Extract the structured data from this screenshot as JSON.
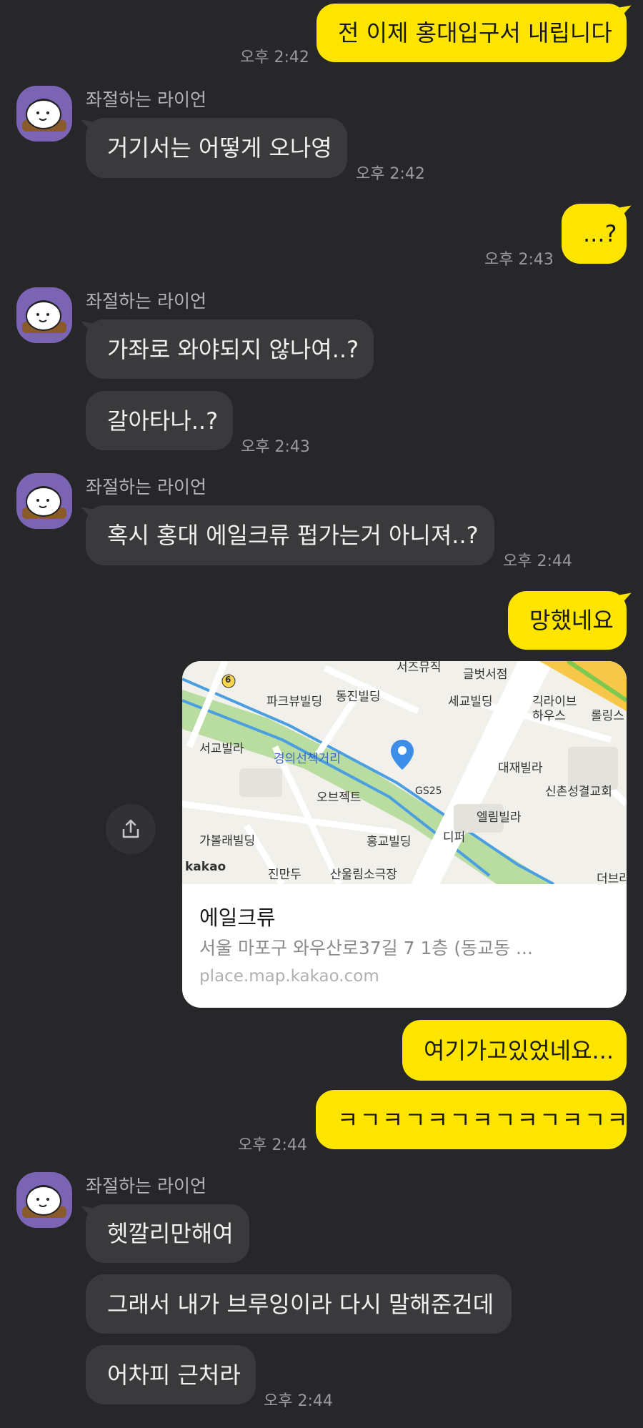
{
  "sender_name": "좌절하는 라이언",
  "colors": {
    "background": "#27272a",
    "incoming_bubble": "#3a3a3d",
    "outgoing_bubble": "#fee500",
    "avatar": "#7b64b4"
  },
  "messages": [
    {
      "text": "전 이제 홍대입구서 내립니다",
      "time": "오후 2:42"
    },
    {
      "text": "거기서는 어떻게 오나영",
      "time": "오후 2:42"
    },
    {
      "text": "...?",
      "time": "오후 2:43"
    },
    {
      "text": "가좌로 와야되지 않나여..?"
    },
    {
      "text": "갈아타나..?",
      "time": "오후 2:43"
    },
    {
      "text": "혹시 홍대 에일크류 펍가는거 아니져..?",
      "time": "오후 2:44"
    },
    {
      "text": "망했네요"
    },
    {
      "text": "여기가고있었네요..."
    },
    {
      "text": "ㅋㄱㅋㄱㅋㄱㅋㄱㅋㄱㅋㄱㅋ",
      "time": "오후 2:44"
    },
    {
      "text": "헷깔리만해여"
    },
    {
      "text": "그래서 내가 브루잉이라 다시 말해준건데"
    },
    {
      "text": "어차피 근처라",
      "time": "오후 2:44"
    }
  ],
  "place_card": {
    "title": "에일크류",
    "address": "서울 마포구 와우산로37길 7 1층 (동교동 ...",
    "url": "place.map.kakao.com",
    "map_labels": [
      "서즈뮤직",
      "글벗서점",
      "파크뷰빌딩",
      "동진빌딩",
      "세교빌딩",
      "긱라이브 하우스",
      "롤링스",
      "서교빌라",
      "경의선책거리",
      "대재빌라",
      "오브젝트",
      "GS25",
      "신촌성결교회",
      "엘림빌라",
      "가볼래빌딩",
      "홍교빌딩",
      "디퍼",
      "진만두",
      "산울림소극장",
      "더브라",
      "kakao",
      "6"
    ]
  }
}
